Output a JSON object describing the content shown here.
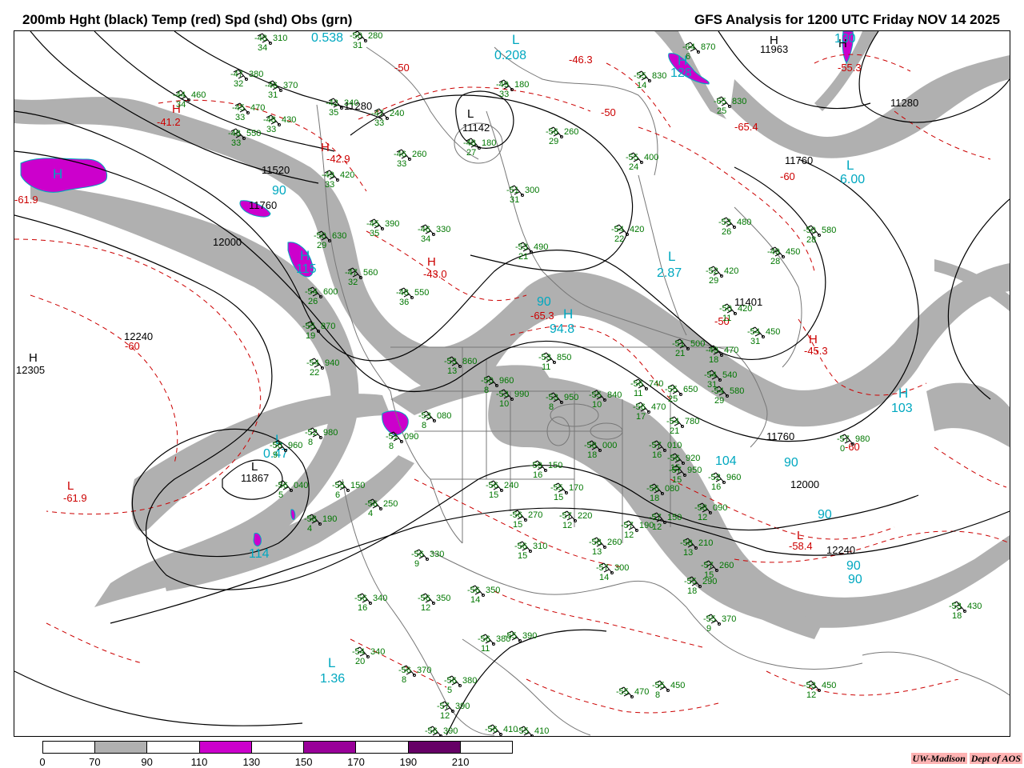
{
  "title_left": "200mb Hght (black) Temp (red) Spd (shd) Obs (grn)",
  "title_right": "GFS Analysis for 1200 UTC Friday  NOV 14 2025",
  "colors": {
    "height": "#000000",
    "temp": "#cc0000",
    "obs": "#007700",
    "speed_label": "#00a8c0",
    "shade_70": "#b0b0b0",
    "shade_110": "#cc00cc",
    "map_lines": "#777777"
  },
  "height_labels": [
    {
      "text": "11280"
    },
    {
      "text": "11280"
    },
    {
      "text": "11520"
    },
    {
      "text": "11760"
    },
    {
      "text": "12000"
    },
    {
      "text": "12240"
    },
    {
      "text": "11963"
    },
    {
      "text": "11760"
    },
    {
      "text": "11401"
    },
    {
      "text": "11760"
    },
    {
      "text": "12000"
    },
    {
      "text": "12240"
    },
    {
      "text": "11142"
    },
    {
      "text": "12305"
    },
    {
      "text": "11867"
    }
  ],
  "pressure_centers": [
    {
      "type": "H"
    },
    {
      "type": "H"
    },
    {
      "type": "L"
    },
    {
      "type": "L"
    },
    {
      "type": "H"
    }
  ],
  "temp_labels": [
    {
      "text": "-41.2"
    },
    {
      "text": "-43.0"
    },
    {
      "text": "-65.3"
    },
    {
      "text": "-45.3"
    },
    {
      "text": "-58.4"
    },
    {
      "text": "-61.9"
    },
    {
      "text": "-61.9"
    },
    {
      "text": "-60"
    },
    {
      "text": "-60"
    },
    {
      "text": "-50"
    },
    {
      "text": "-50"
    },
    {
      "text": "-46.3"
    },
    {
      "text": "-55.3"
    },
    {
      "text": "-65.4"
    },
    {
      "text": "-50"
    },
    {
      "text": "-60"
    },
    {
      "text": "-42.9"
    }
  ],
  "temp_centers": [
    {
      "type": "H"
    },
    {
      "type": "H"
    },
    {
      "type": "H"
    },
    {
      "type": "H"
    },
    {
      "type": "L"
    },
    {
      "type": "L"
    }
  ],
  "speed_labels": [
    {
      "text": "0.538"
    },
    {
      "text": "0.208"
    },
    {
      "text": "2.87"
    },
    {
      "text": "6.00"
    },
    {
      "text": "94.8"
    },
    {
      "text": "103"
    },
    {
      "text": "90"
    },
    {
      "text": "90"
    },
    {
      "text": "90"
    },
    {
      "text": "90"
    },
    {
      "text": "104"
    },
    {
      "text": "0.47"
    },
    {
      "text": "114"
    },
    {
      "text": "1.36"
    },
    {
      "text": "90"
    },
    {
      "text": "128"
    },
    {
      "text": "115"
    },
    {
      "text": "130"
    },
    {
      "text": "90"
    }
  ],
  "speed_centers": [
    {
      "type": "H"
    },
    {
      "type": "L"
    },
    {
      "type": "L"
    },
    {
      "type": "L"
    },
    {
      "type": "H"
    },
    {
      "type": "L"
    },
    {
      "type": "H"
    },
    {
      "type": "L"
    },
    {
      "type": "H"
    },
    {
      "type": "H"
    }
  ],
  "obs": [
    {
      "t": "-48",
      "h": "310",
      "d": "34"
    },
    {
      "t": "-47",
      "h": "380",
      "d": "32"
    },
    {
      "t": "-44",
      "h": "460",
      "d": "34"
    },
    {
      "t": "-46",
      "h": "370",
      "d": "31"
    },
    {
      "t": "-42",
      "h": "340",
      "d": "35"
    },
    {
      "t": "-45",
      "h": "470",
      "d": "33"
    },
    {
      "t": "-48",
      "h": "430",
      "d": "33"
    },
    {
      "t": "-48",
      "h": "550",
      "d": "33"
    },
    {
      "t": "-47",
      "h": "240",
      "d": "33"
    },
    {
      "t": "-49",
      "h": "180",
      "d": "33"
    },
    {
      "t": "-46",
      "h": "260",
      "d": "33"
    },
    {
      "t": "-48",
      "h": "180",
      "d": "27"
    },
    {
      "t": "-56",
      "h": "260",
      "d": "29"
    },
    {
      "t": "-55",
      "h": "400",
      "d": "24"
    },
    {
      "t": "-51",
      "h": "300",
      "d": "31"
    },
    {
      "t": "-50",
      "h": "280",
      "d": "31"
    },
    {
      "t": "-49",
      "h": "420",
      "d": "33"
    },
    {
      "t": "-45",
      "h": "390",
      "d": "35"
    },
    {
      "t": "-46",
      "h": "330",
      "d": "34"
    },
    {
      "t": "-53",
      "h": "490",
      "d": "21"
    },
    {
      "t": "-54",
      "h": "420",
      "d": "22"
    },
    {
      "t": "-50",
      "h": "630",
      "d": "29"
    },
    {
      "t": "-47",
      "h": "560",
      "d": "32"
    },
    {
      "t": "-48",
      "h": "550",
      "d": "36"
    },
    {
      "t": "-54",
      "h": "600",
      "d": "26"
    },
    {
      "t": "-55",
      "h": "870",
      "d": "19"
    },
    {
      "t": "-54",
      "h": "940",
      "d": "22"
    },
    {
      "t": "-53",
      "h": "860",
      "d": "13"
    },
    {
      "t": "-53",
      "h": "850",
      "d": "11"
    },
    {
      "t": "-50",
      "h": "960",
      "d": "8"
    },
    {
      "t": "-53",
      "h": "990",
      "d": "10"
    },
    {
      "t": "-53",
      "h": "950",
      "d": "8"
    },
    {
      "t": "-58",
      "h": "000",
      "d": "18"
    },
    {
      "t": "-55",
      "h": "840",
      "d": "10"
    },
    {
      "t": "-56",
      "h": "740",
      "d": "11"
    },
    {
      "t": "-56",
      "h": "470",
      "d": "17"
    },
    {
      "t": "-55",
      "h": "650",
      "d": "25"
    },
    {
      "t": "-54",
      "h": "780",
      "d": "21"
    },
    {
      "t": "-51",
      "h": "500",
      "d": "21"
    },
    {
      "t": "-49",
      "h": "470",
      "d": "18"
    },
    {
      "t": "-54",
      "h": "540",
      "d": "31"
    },
    {
      "t": "-54",
      "h": "580",
      "d": "29"
    },
    {
      "t": "-52",
      "h": "420",
      "d": "29"
    },
    {
      "t": "-50",
      "h": "420",
      "d": "11"
    },
    {
      "t": "-49",
      "h": "450",
      "d": "28"
    },
    {
      "t": "-50",
      "h": "580",
      "d": "28"
    },
    {
      "t": "-53",
      "h": "480",
      "d": "26"
    },
    {
      "t": "-54",
      "h": "450",
      "d": "31"
    },
    {
      "t": "-64",
      "h": "870",
      "d": "6"
    },
    {
      "t": "-55",
      "h": "830",
      "d": "14"
    },
    {
      "t": "-65",
      "h": "830",
      "d": "25"
    },
    {
      "t": "-52",
      "h": "980",
      "d": "8"
    },
    {
      "t": "-50",
      "h": "960",
      "d": "9"
    },
    {
      "t": "-53",
      "h": "080",
      "d": "8"
    },
    {
      "t": "-51",
      "h": "090",
      "d": "8"
    },
    {
      "t": "-57",
      "h": "980",
      "d": "0"
    },
    {
      "t": "-56",
      "h": "040",
      "d": "5"
    },
    {
      "t": "-55",
      "h": "150",
      "d": "6"
    },
    {
      "t": "-56",
      "h": "250",
      "d": "4"
    },
    {
      "t": "-58",
      "h": "190",
      "d": "4"
    },
    {
      "t": "-56",
      "h": "240",
      "d": "15"
    },
    {
      "t": "-59",
      "h": "150",
      "d": "16"
    },
    {
      "t": "-55",
      "h": "170",
      "d": "15"
    },
    {
      "t": "-56",
      "h": "270",
      "d": "15"
    },
    {
      "t": "-57",
      "h": "220",
      "d": "12"
    },
    {
      "t": "-56",
      "h": "310",
      "d": "15"
    },
    {
      "t": "-56",
      "h": "330",
      "d": "9"
    },
    {
      "t": "-58",
      "h": "260",
      "d": "13"
    },
    {
      "t": "-57",
      "h": "300",
      "d": "14"
    },
    {
      "t": "-57",
      "h": "190",
      "d": "12"
    },
    {
      "t": "-56",
      "h": "080",
      "d": "18"
    },
    {
      "t": "-57",
      "h": "150",
      "d": "12"
    },
    {
      "t": "-57",
      "h": "010",
      "d": "16"
    },
    {
      "t": "-56",
      "h": "920",
      "d": "15"
    },
    {
      "t": "-57",
      "h": "950",
      "d": "15"
    },
    {
      "t": "-52",
      "h": "960",
      "d": "16"
    },
    {
      "t": "-58",
      "h": "090",
      "d": "12"
    },
    {
      "t": "-58",
      "h": "210",
      "d": "13"
    },
    {
      "t": "-57",
      "h": "260",
      "d": "15"
    },
    {
      "t": "-55",
      "h": "290",
      "d": "18"
    },
    {
      "t": "-55",
      "h": "370",
      "d": "9"
    },
    {
      "t": "-53",
      "h": "430",
      "d": "18"
    },
    {
      "t": "-56",
      "h": "340",
      "d": "16"
    },
    {
      "t": "-56",
      "h": "350",
      "d": "12"
    },
    {
      "t": "-56",
      "h": "350",
      "d": "14"
    },
    {
      "t": "-54",
      "h": "340",
      "d": "20"
    },
    {
      "t": "-56",
      "h": "370",
      "d": "8"
    },
    {
      "t": "-56",
      "h": "380",
      "d": "5"
    },
    {
      "t": "-56",
      "h": "380",
      "d": "11"
    },
    {
      "t": "-55",
      "h": "390",
      "d": ""
    },
    {
      "t": "-57",
      "h": "390",
      "d": "12"
    },
    {
      "t": "-56",
      "h": "390",
      "d": ""
    },
    {
      "t": "-56",
      "h": "410",
      "d": ""
    },
    {
      "t": "-55",
      "h": "410",
      "d": ""
    },
    {
      "t": "-55",
      "h": "470",
      "d": ""
    },
    {
      "t": "-55",
      "h": "450",
      "d": "8"
    },
    {
      "t": "-53",
      "h": "450",
      "d": "12"
    }
  ],
  "legend": {
    "values": [
      "0",
      "70",
      "90",
      "110",
      "130",
      "150",
      "170",
      "190",
      "210"
    ],
    "colors": [
      "#ffffff",
      "#b0b0b0",
      "#ffffff",
      "#cc00cc",
      "#ffffff",
      "#990099",
      "#ffffff",
      "#660066",
      "#ffffff"
    ]
  },
  "credit": {
    "org": "UW-Madison",
    "dept": "Dept of AOS"
  }
}
